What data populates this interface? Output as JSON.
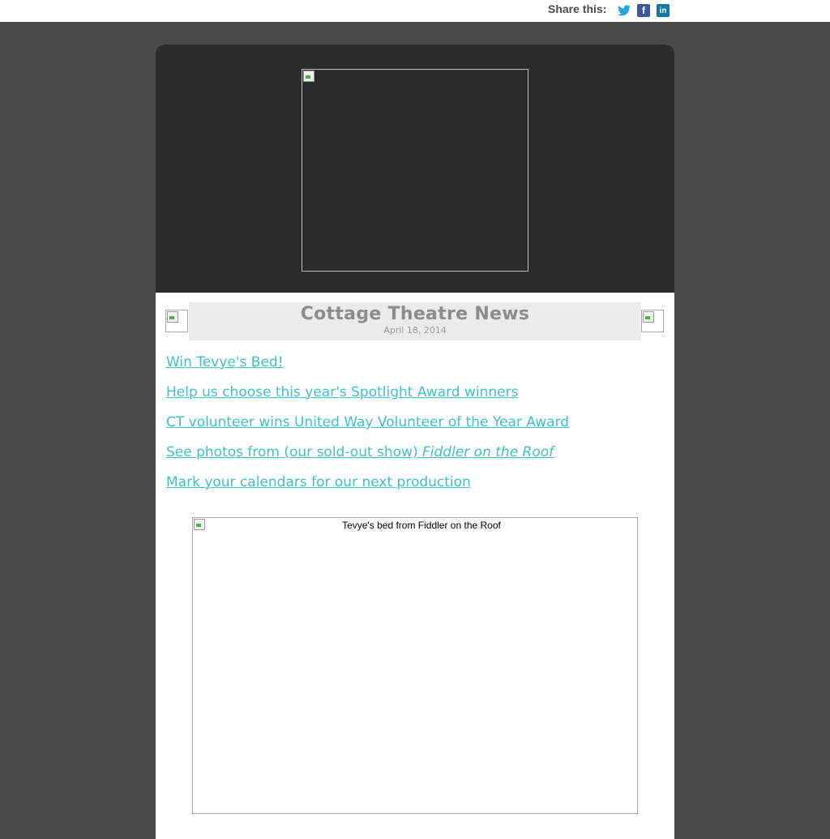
{
  "share": {
    "label": "Share this:",
    "icons": [
      "twitter-icon",
      "facebook-icon",
      "linkedin-icon"
    ]
  },
  "colors": {
    "page_background": "#4a4a4a",
    "header_background": "#2b2b2b",
    "link": "#3fc0c8",
    "title": "#8c8c8c",
    "title_box": "#ebebeb"
  },
  "newsletter": {
    "title": "Cottage Theatre News",
    "date": "April 18, 2014"
  },
  "links": [
    {
      "text": "Win Tevye's Bed!"
    },
    {
      "text": "Help us choose this year's Spotlight Award winners"
    },
    {
      "text": "CT volunteer wins United Way Volunteer of the Year Award"
    },
    {
      "text": "See photos from (our sold-out show) ",
      "emphasis": "Fiddler on the Roof"
    },
    {
      "text": "Mark your calendars for our next production "
    }
  ],
  "feature_image": {
    "alt": "Tevye's bed from Fiddler on the Roof"
  }
}
